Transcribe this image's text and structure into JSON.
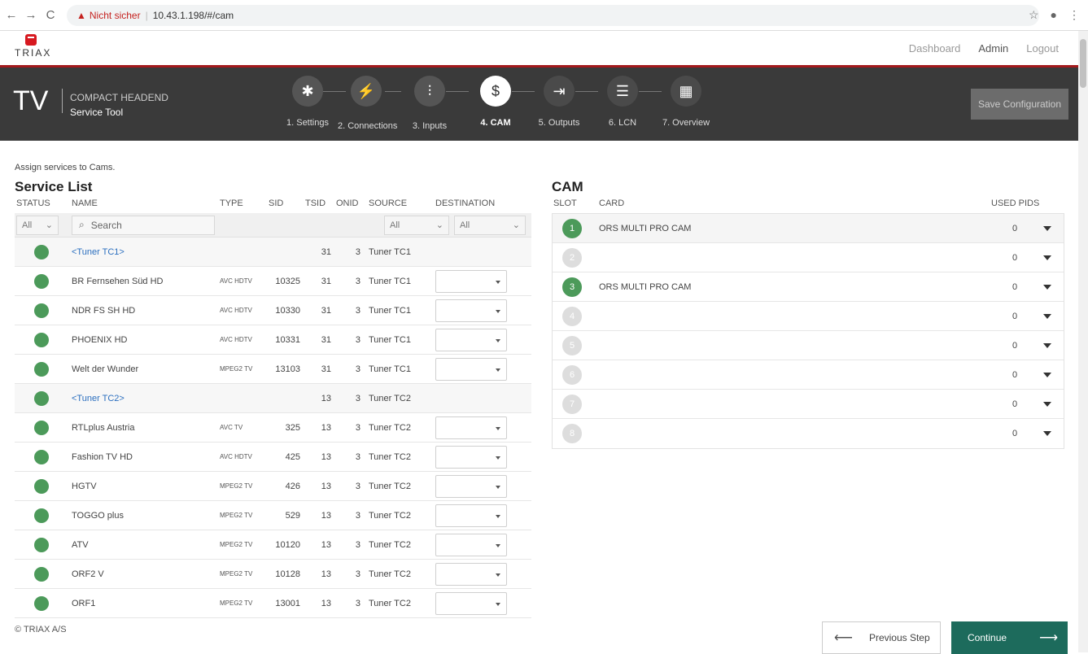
{
  "browser": {
    "back": "←",
    "forward": "→",
    "reload": "C",
    "security_label": "Nicht sicher",
    "url": "10.43.1.198/#/cam"
  },
  "app": {
    "logo_text": "TRIAX",
    "nav": [
      "Dashboard",
      "Admin",
      "Logout"
    ],
    "title_big": "TV",
    "title_line1": "COMPACT HEADEND",
    "title_line2": "Service Tool",
    "save_label": "Save Configuration"
  },
  "steps": [
    {
      "label": "1. Settings",
      "icon": "gear-icon",
      "glyph": "✱"
    },
    {
      "label": "2. Connections",
      "icon": "plug-icon",
      "glyph": "⚡"
    },
    {
      "label": "3. Inputs",
      "icon": "sliders-icon",
      "glyph": "⫶"
    },
    {
      "label": "4. CAM",
      "icon": "cam-card-icon",
      "glyph": "$"
    },
    {
      "label": "5. Outputs",
      "icon": "exit-icon",
      "glyph": "⇥"
    },
    {
      "label": "6. LCN",
      "icon": "list-icon",
      "glyph": "☰"
    },
    {
      "label": "7. Overview",
      "icon": "grid-icon",
      "glyph": "▦"
    }
  ],
  "hint": "Assign services to Cams.",
  "service_list": {
    "title": "Service List",
    "columns": [
      "STATUS",
      "NAME",
      "TYPE",
      "SID",
      "TSID",
      "ONID",
      "SOURCE",
      "DESTINATION"
    ],
    "filter_status": "All",
    "search_placeholder": "Search",
    "filter_source": "All",
    "filter_dest": "All",
    "rows": [
      {
        "name": "<Tuner TC1>",
        "type": "",
        "sid": "",
        "tsid": "31",
        "onid": "3",
        "source": "Tuner TC1",
        "tuner": true
      },
      {
        "name": "BR Fernsehen Süd HD",
        "type": "AVC HDTV",
        "sid": "10325",
        "tsid": "31",
        "onid": "3",
        "source": "Tuner TC1",
        "tuner": false
      },
      {
        "name": "NDR FS SH HD",
        "type": "AVC HDTV",
        "sid": "10330",
        "tsid": "31",
        "onid": "3",
        "source": "Tuner TC1",
        "tuner": false
      },
      {
        "name": "PHOENIX HD",
        "type": "AVC HDTV",
        "sid": "10331",
        "tsid": "31",
        "onid": "3",
        "source": "Tuner TC1",
        "tuner": false
      },
      {
        "name": "Welt der Wunder",
        "type": "MPEG2 TV",
        "sid": "13103",
        "tsid": "31",
        "onid": "3",
        "source": "Tuner TC1",
        "tuner": false
      },
      {
        "name": "<Tuner TC2>",
        "type": "",
        "sid": "",
        "tsid": "13",
        "onid": "3",
        "source": "Tuner TC2",
        "tuner": true
      },
      {
        "name": "RTLplus Austria",
        "type": "AVC TV",
        "sid": "325",
        "tsid": "13",
        "onid": "3",
        "source": "Tuner TC2",
        "tuner": false
      },
      {
        "name": "Fashion TV HD",
        "type": "AVC HDTV",
        "sid": "425",
        "tsid": "13",
        "onid": "3",
        "source": "Tuner TC2",
        "tuner": false
      },
      {
        "name": "HGTV",
        "type": "MPEG2 TV",
        "sid": "426",
        "tsid": "13",
        "onid": "3",
        "source": "Tuner TC2",
        "tuner": false
      },
      {
        "name": "TOGGO plus",
        "type": "MPEG2 TV",
        "sid": "529",
        "tsid": "13",
        "onid": "3",
        "source": "Tuner TC2",
        "tuner": false
      },
      {
        "name": "ATV",
        "type": "MPEG2 TV",
        "sid": "10120",
        "tsid": "13",
        "onid": "3",
        "source": "Tuner TC2",
        "tuner": false
      },
      {
        "name": "ORF2 V",
        "type": "MPEG2 TV",
        "sid": "10128",
        "tsid": "13",
        "onid": "3",
        "source": "Tuner TC2",
        "tuner": false
      },
      {
        "name": "ORF1",
        "type": "MPEG2 TV",
        "sid": "13001",
        "tsid": "13",
        "onid": "3",
        "source": "Tuner TC2",
        "tuner": false
      }
    ]
  },
  "cam": {
    "title": "CAM",
    "columns": [
      "SLOT",
      "CARD",
      "USED PIDS"
    ],
    "slots": [
      {
        "num": "1",
        "card": "ORS MULTI PRO CAM",
        "pids": "0",
        "active": true
      },
      {
        "num": "2",
        "card": "",
        "pids": "0",
        "active": false
      },
      {
        "num": "3",
        "card": "ORS MULTI PRO CAM",
        "pids": "0",
        "active": true
      },
      {
        "num": "4",
        "card": "",
        "pids": "0",
        "active": false
      },
      {
        "num": "5",
        "card": "",
        "pids": "0",
        "active": false
      },
      {
        "num": "6",
        "card": "",
        "pids": "0",
        "active": false
      },
      {
        "num": "7",
        "card": "",
        "pids": "0",
        "active": false
      },
      {
        "num": "8",
        "card": "",
        "pids": "0",
        "active": false
      }
    ]
  },
  "footer": {
    "copyright": "© TRIAX A/S",
    "prev_label": "Previous Step",
    "next_label": "Continue"
  },
  "colors": {
    "header_bg": "#3a3a3a",
    "brand_red": "#d71920",
    "status_green": "#4c9a5a",
    "continue_bg": "#1d6b5c",
    "link_blue": "#2b6fbf"
  }
}
